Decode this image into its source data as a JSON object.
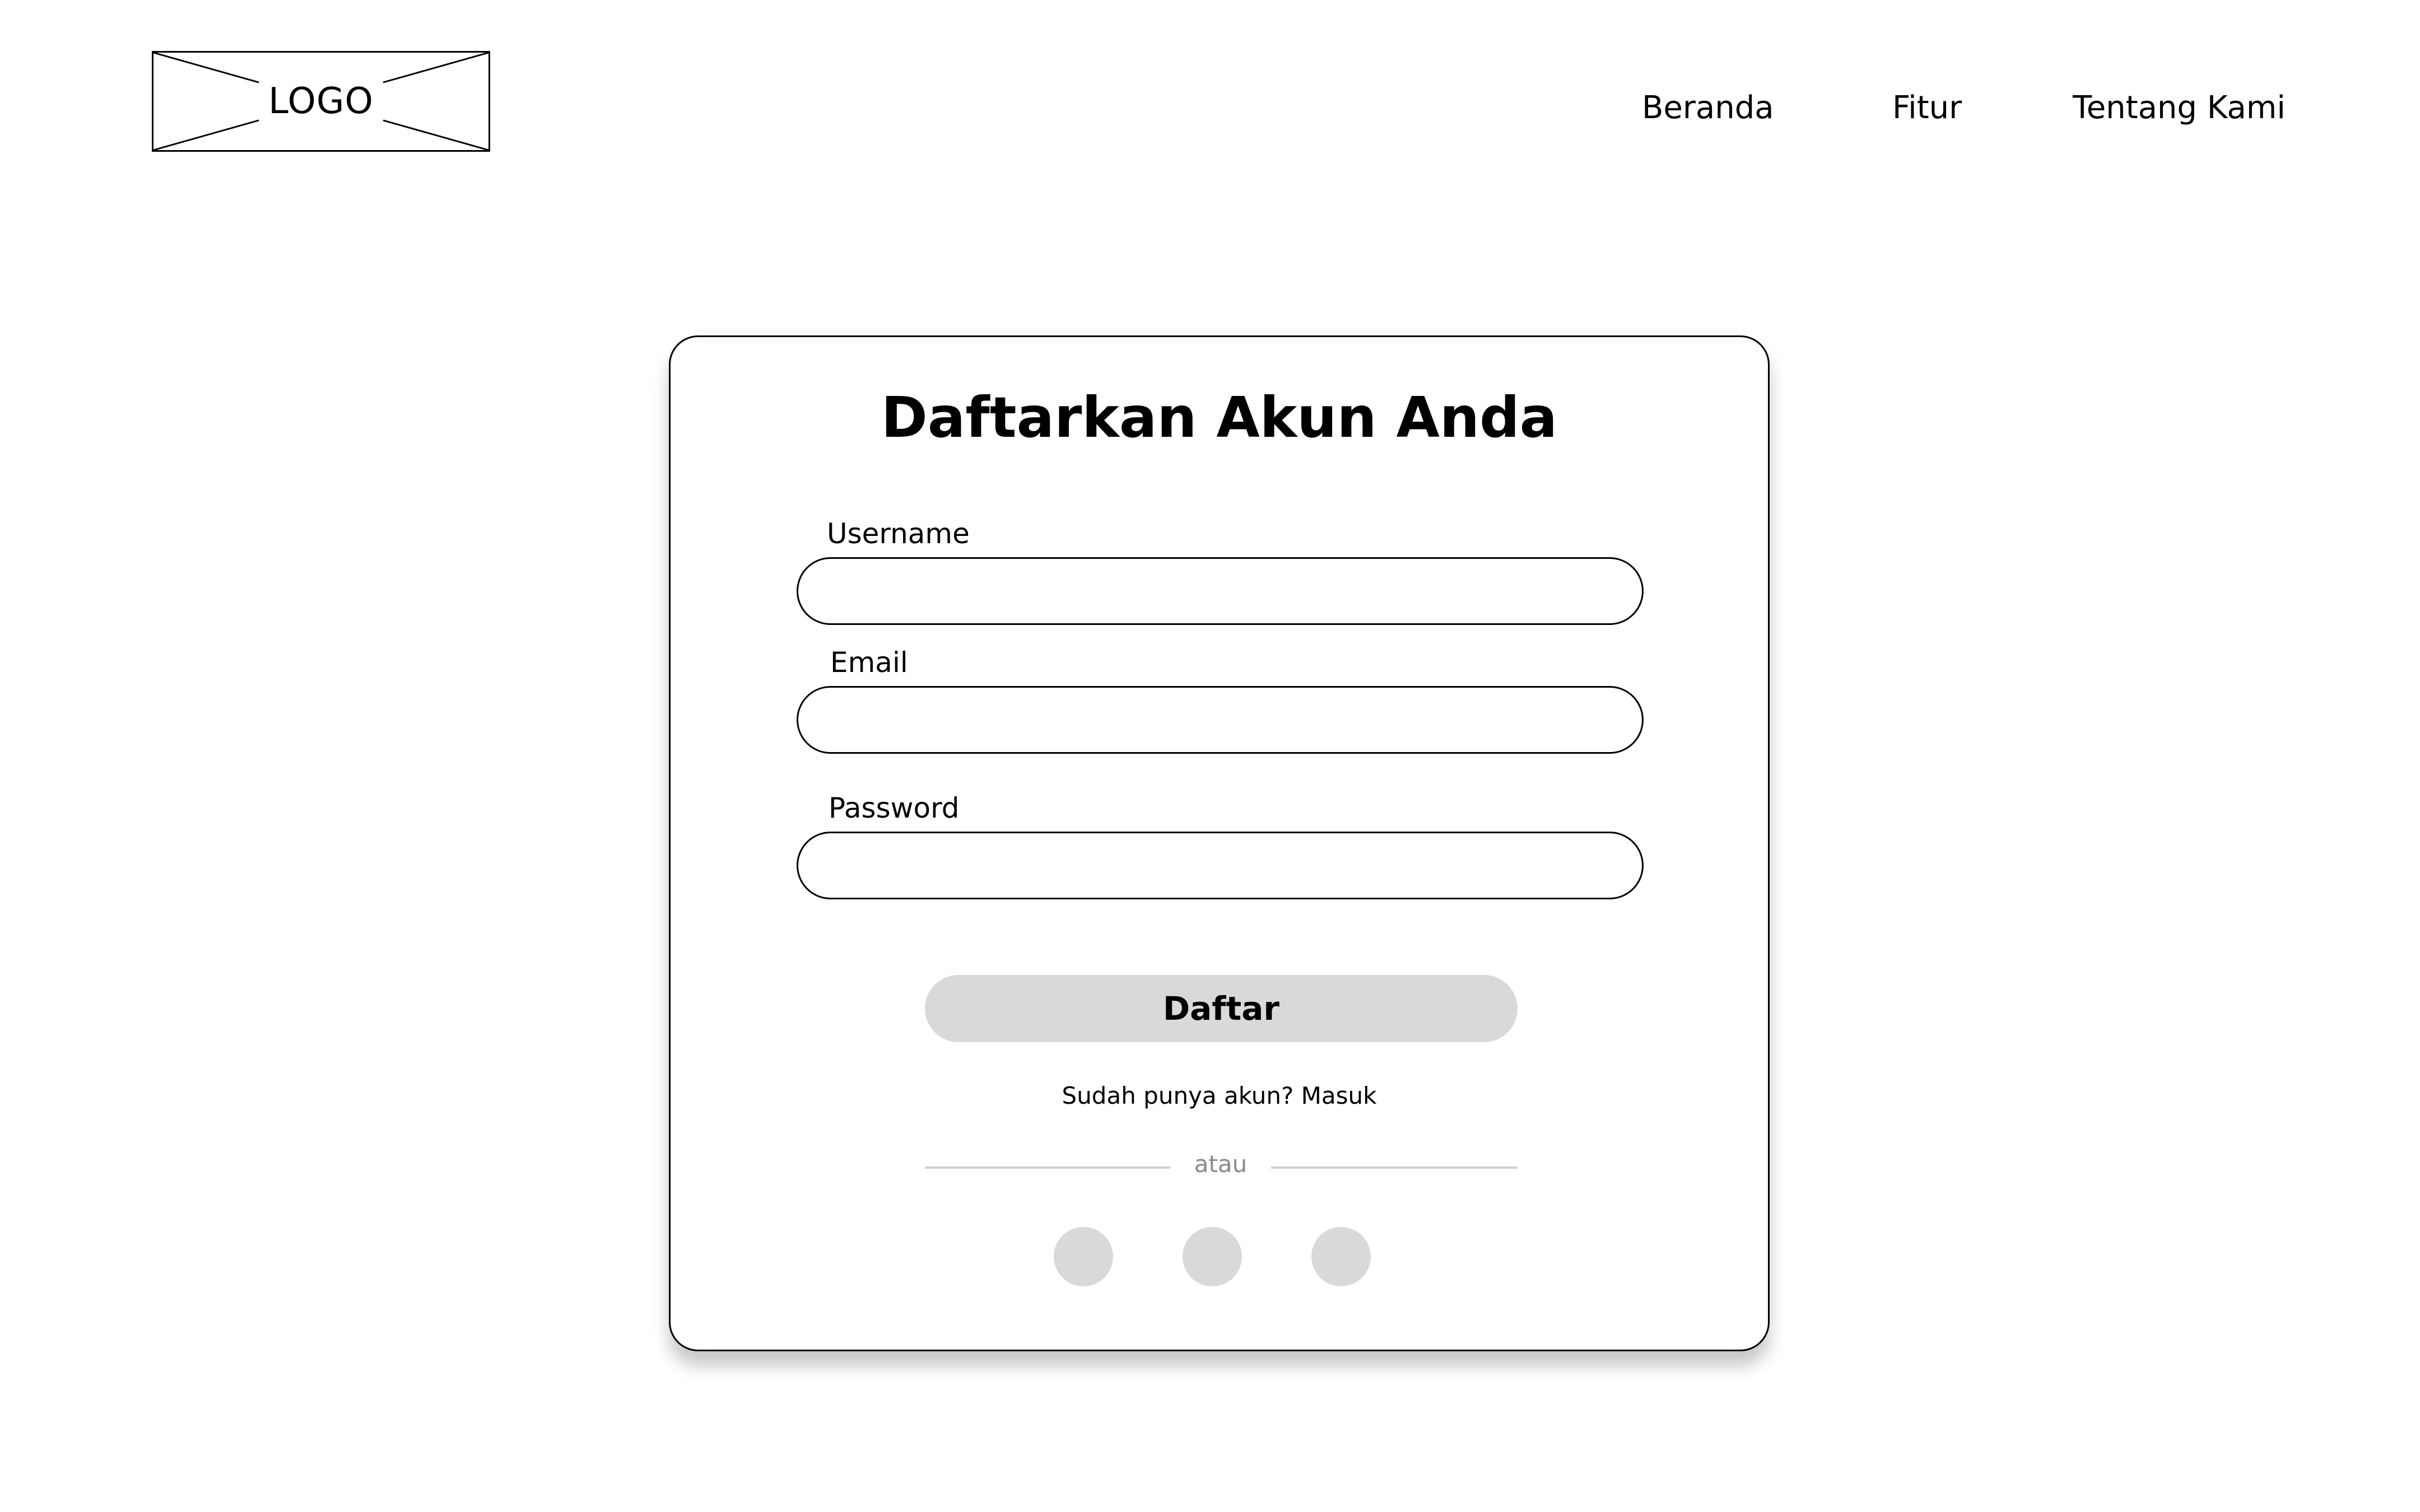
{
  "header": {
    "logo_text": "LOGO",
    "nav": [
      "Beranda",
      "Fitur",
      "Tentang Kami"
    ]
  },
  "form": {
    "title": "Daftarkan Akun Anda",
    "fields": [
      {
        "label": "Username",
        "value": "",
        "placeholder": ""
      },
      {
        "label": "Email",
        "value": "",
        "placeholder": ""
      },
      {
        "label": "Password",
        "value": "",
        "placeholder": ""
      }
    ],
    "submit_label": "Daftar",
    "login_prompt": "Sudah punya akun? Masuk",
    "divider_text": "atau",
    "social_buttons": [
      "social-button-1",
      "social-button-2",
      "social-button-3"
    ]
  },
  "colors": {
    "background": "#ffffff",
    "border": "#000000",
    "button_fill": "#d9d9d9",
    "divider": "#d0d0d0",
    "muted_text": "#8a8a8a"
  }
}
